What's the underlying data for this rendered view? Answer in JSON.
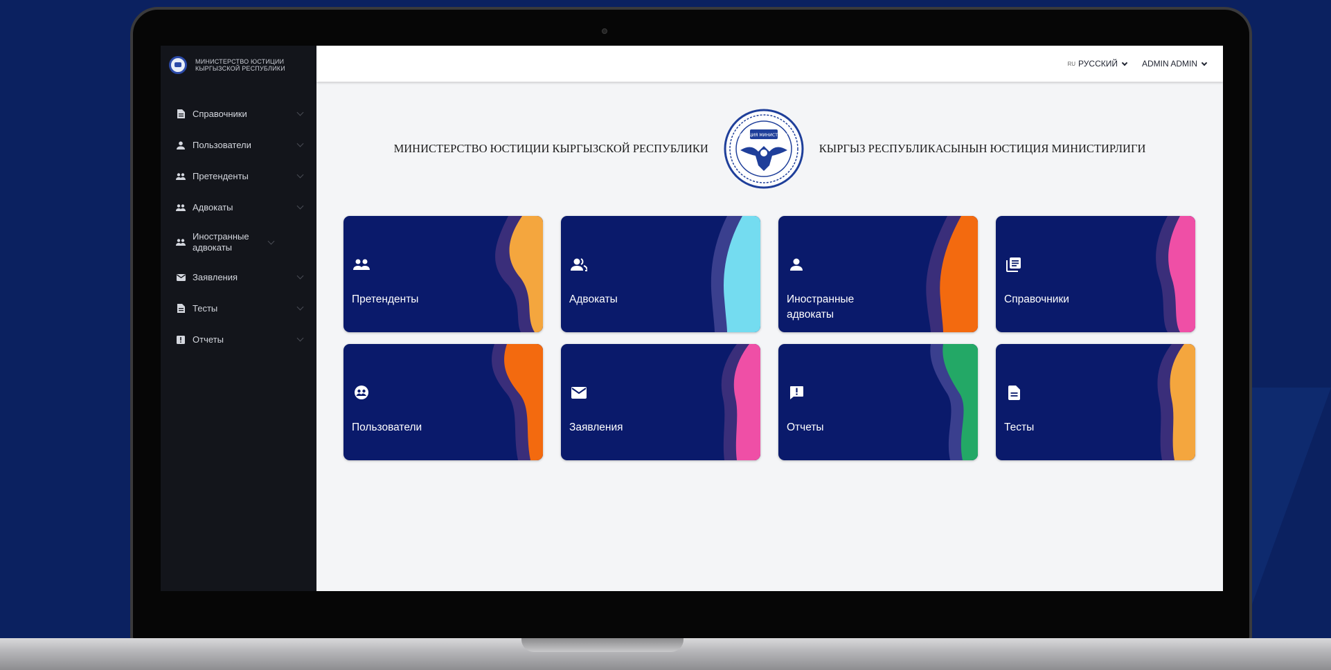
{
  "brand": {
    "line1": "МИНИСТЕРСТВО ЮСТИЦИИ",
    "line2": "КЫРГЫЗСКОЙ РЕСПУБЛИКИ"
  },
  "sidebar": {
    "items": [
      {
        "label": "Справочники",
        "icon": "document-icon"
      },
      {
        "label": "Пользователи",
        "icon": "person-icon"
      },
      {
        "label": "Претенденты",
        "icon": "people-icon"
      },
      {
        "label": "Адвокаты",
        "icon": "people-icon"
      },
      {
        "label": "Иностранные адвокаты",
        "icon": "people-icon"
      },
      {
        "label": "Заявления",
        "icon": "mail-icon"
      },
      {
        "label": "Тесты",
        "icon": "document-icon"
      },
      {
        "label": "Отчеты",
        "icon": "report-icon"
      }
    ]
  },
  "topbar": {
    "lang_flag": "RU",
    "language": "РУССКИЙ",
    "user": "ADMIN ADMIN"
  },
  "header": {
    "left": "МИНИСТЕРСТВО ЮСТИЦИИ КЫРГЫЗСКОЙ РЕСПУБЛИКИ",
    "right": "КЫРГЫЗ РЕСПУБЛИКАСЫНЫН ЮСТИЦИЯ МИНИСТИРЛИГИ",
    "seal_text": "ЮСТИЦИЯ МИНИСТРЛИГИ"
  },
  "cards": [
    {
      "label": "Претенденты",
      "icon": "people-icon",
      "color": "#f4a63e"
    },
    {
      "label": "Адвокаты",
      "icon": "group-icon",
      "color": "#74dcf0"
    },
    {
      "label": "Иностранные адвокаты",
      "icon": "person-icon",
      "color": "#f36a0f"
    },
    {
      "label": "Справочники",
      "icon": "list-book-icon",
      "color": "#ef4fa6"
    },
    {
      "label": "Пользователи",
      "icon": "users-circle-icon",
      "color": "#f36a0f"
    },
    {
      "label": "Заявления",
      "icon": "mail-icon",
      "color": "#ef4fa6"
    },
    {
      "label": "Отчеты",
      "icon": "report-icon",
      "color": "#23a866"
    },
    {
      "label": "Тесты",
      "icon": "document-icon",
      "color": "#f4a63e"
    }
  ],
  "colors": {
    "card_bg": "#0a1a6b",
    "sidebar_bg": "#13151b",
    "page_bg": "#0b2160"
  }
}
